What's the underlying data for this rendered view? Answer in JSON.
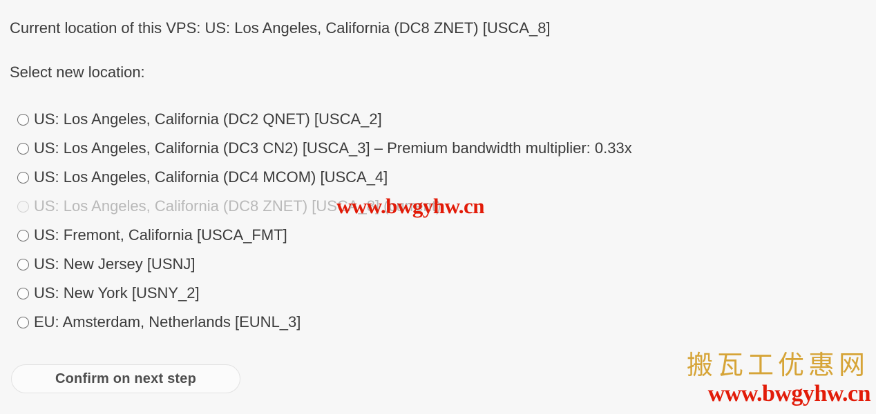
{
  "page": {
    "background_color": "#f7f7f7",
    "text_color": "#3b3b3b"
  },
  "header": {
    "current_location_text": "Current location of this VPS: US: Los Angeles, California (DC8 ZNET) [USCA_8]",
    "select_label": "Select new location:"
  },
  "locations": [
    {
      "label": "US: Los Angeles, California (DC2 QNET) [USCA_2]",
      "code": "USCA_2",
      "selected": false,
      "disabled": false
    },
    {
      "label": "US: Los Angeles, California (DC3 CN2) [USCA_3] – Premium bandwidth multiplier: 0.33x",
      "code": "USCA_3",
      "selected": false,
      "disabled": false
    },
    {
      "label": "US: Los Angeles, California (DC4 MCOM) [USCA_4]",
      "code": "USCA_4",
      "selected": false,
      "disabled": false
    },
    {
      "label": "US: Los Angeles, California (DC8 ZNET) [USCA_8] (current)",
      "code": "USCA_8",
      "selected": false,
      "disabled": true
    },
    {
      "label": "US: Fremont, California [USCA_FMT]",
      "code": "USCA_FMT",
      "selected": false,
      "disabled": false
    },
    {
      "label": "US: New Jersey [USNJ]",
      "code": "USNJ",
      "selected": false,
      "disabled": false
    },
    {
      "label": "US: New York [USNY_2]",
      "code": "USNY_2",
      "selected": false,
      "disabled": false
    },
    {
      "label": "EU: Amsterdam, Netherlands [EUNL_3]",
      "code": "EUNL_3",
      "selected": false,
      "disabled": false
    }
  ],
  "actions": {
    "confirm_label": "Confirm on next step"
  },
  "watermarks": {
    "inline_url": "www.bwgyhw.cn",
    "inline_color": "#e21b08",
    "corner_chinese": "搬瓦工优惠网",
    "corner_chinese_color": "#d6a437",
    "corner_url": "www.bwgyhw.cn",
    "corner_url_color": "#e21b08"
  }
}
